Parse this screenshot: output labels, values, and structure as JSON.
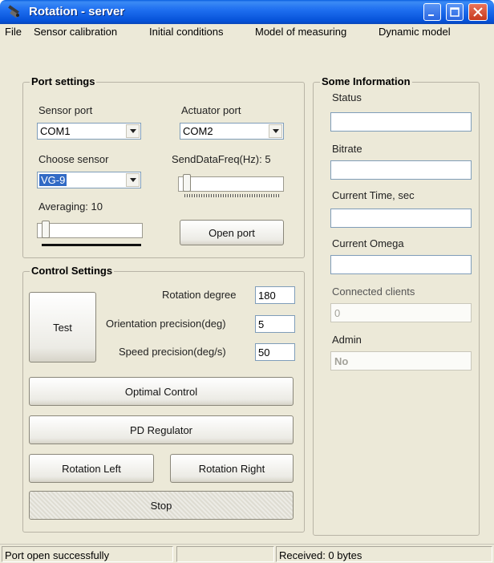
{
  "window": {
    "title": "Rotation - server",
    "icon": "satellite-icon"
  },
  "menu": [
    "File",
    "Sensor calibration",
    "Initial conditions",
    "Model of measuring",
    "Dynamic model"
  ],
  "port_settings": {
    "title": "Port settings",
    "sensor_port_label": "Sensor port",
    "sensor_port_value": "COM1",
    "actuator_port_label": "Actuator port",
    "actuator_port_value": "COM2",
    "choose_sensor_label": "Choose sensor",
    "choose_sensor_value": "VG-9",
    "send_freq_label": "SendDataFreq(Hz): 5",
    "averaging_label": "Averaging: 10",
    "open_port_button": "Open port"
  },
  "control_settings": {
    "title": "Control Settings",
    "test_button": "Test",
    "rotation_degree_label": "Rotation degree",
    "rotation_degree_value": "180",
    "orientation_precision_label": "Orientation precision(deg)",
    "orientation_precision_value": "5",
    "speed_precision_label": "Speed precision(deg/s)",
    "speed_precision_value": "50",
    "optimal_control_button": "Optimal Control",
    "pd_regulator_button": "PD Regulator",
    "rotation_left_button": "Rotation Left",
    "rotation_right_button": "Rotation Right",
    "stop_button": "Stop"
  },
  "info": {
    "title": "Some Information",
    "status_label": "Status",
    "status_value": "",
    "bitrate_label": "Bitrate",
    "bitrate_value": "",
    "current_time_label": "Current Time, sec",
    "current_time_value": "",
    "current_omega_label": "Current Omega",
    "current_omega_value": "",
    "connected_clients_label": "Connected clients",
    "connected_clients_value": "0",
    "admin_label": "Admin",
    "admin_value": "No"
  },
  "statusbar": {
    "message": "Port open successfully",
    "middle": "",
    "received": "Received: 0 bytes"
  },
  "colors": {
    "titlebar": "#0551d8",
    "face": "#ece9d8",
    "selection": "#316ac5"
  }
}
